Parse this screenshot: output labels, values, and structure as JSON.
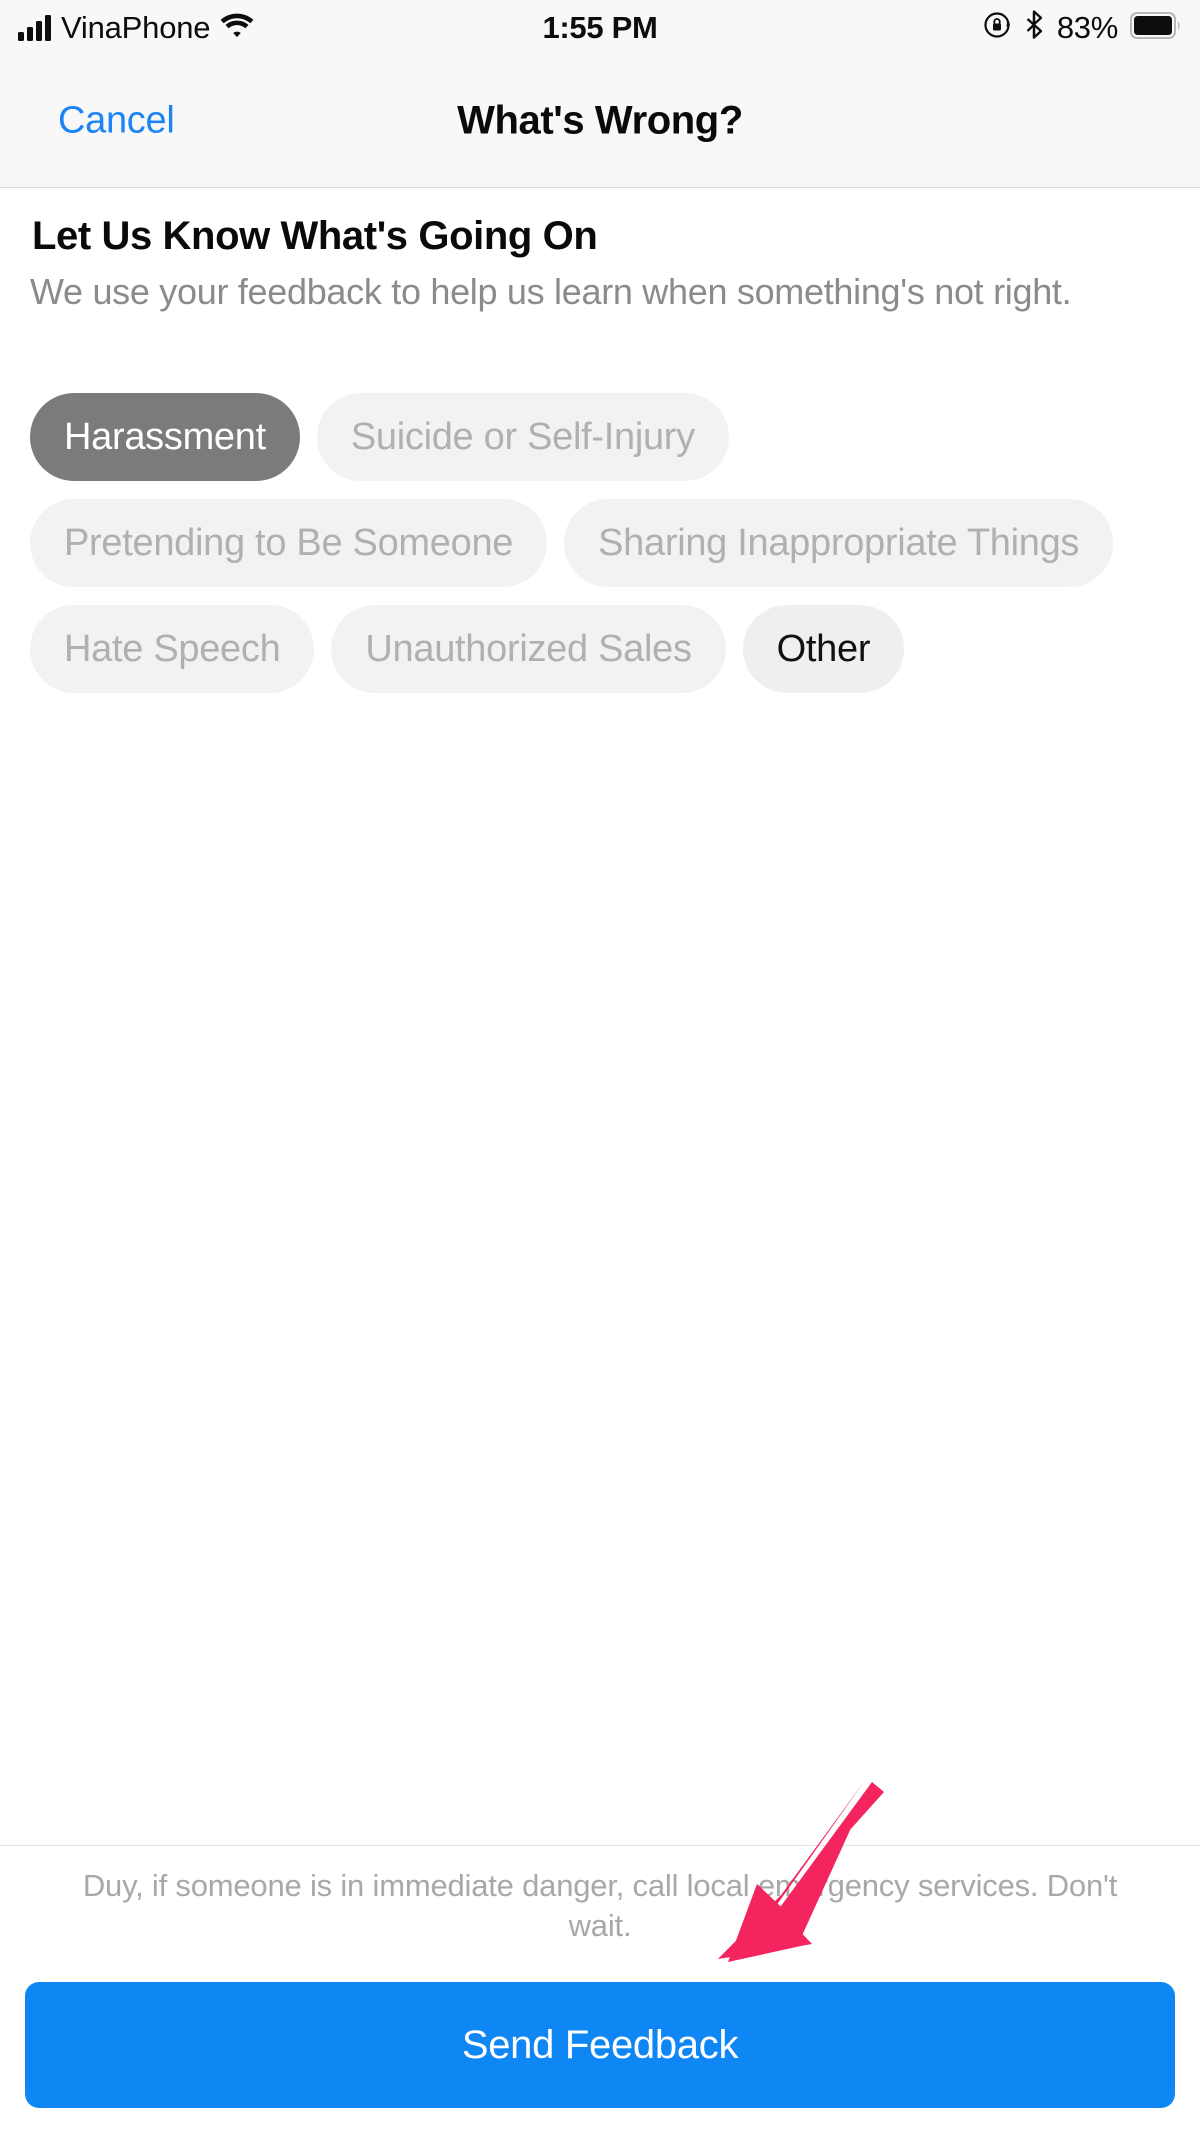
{
  "status_bar": {
    "carrier": "VinaPhone",
    "signal_icon": "signal-bars-icon",
    "wifi_icon": "wifi-icon",
    "time": "1:55 PM",
    "rotation_lock_icon": "rotation-lock-icon",
    "bluetooth_icon": "bluetooth-icon",
    "battery_percent": "83%",
    "battery_icon": "battery-icon"
  },
  "nav_bar": {
    "cancel_label": "Cancel",
    "title": "What's Wrong?"
  },
  "content": {
    "section_title": "Let Us Know What's Going On",
    "section_subtitle": "We use your feedback to help us learn when something's not right.",
    "chips": [
      {
        "label": "Harassment",
        "state": "selected"
      },
      {
        "label": "Suicide or Self-Injury",
        "state": "default"
      },
      {
        "label": "Pretending to Be Someone",
        "state": "default"
      },
      {
        "label": "Sharing Inappropriate Things",
        "state": "default"
      },
      {
        "label": "Hate Speech",
        "state": "default"
      },
      {
        "label": "Unauthorized Sales",
        "state": "default"
      },
      {
        "label": "Other",
        "state": "emphasis"
      }
    ]
  },
  "footer": {
    "note": "Duy, if someone is in immediate danger, call local emergency services. Don't wait.",
    "send_label": "Send Feedback"
  },
  "annotation": {
    "arrow_icon": "pink-arrow-annotation",
    "arrow_color": "#F4245E"
  },
  "colors": {
    "accent_blue": "#0E87F5",
    "link_blue": "#1D84F4",
    "chip_bg": "#F2F2F2",
    "chip_selected_bg": "#7B7B7B",
    "chip_text": "#B0B0B0",
    "muted_text": "#8B8B8B",
    "bar_bg": "#F8F8F8"
  }
}
